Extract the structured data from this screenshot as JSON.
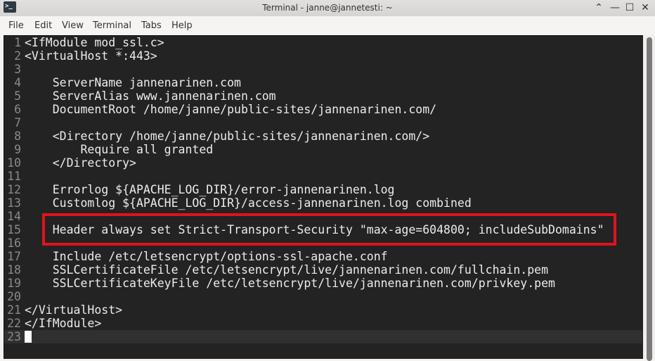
{
  "window": {
    "title": "Terminal - janne@jannetesti: ~",
    "icon_text": ">_"
  },
  "menu": [
    "File",
    "Edit",
    "View",
    "Terminal",
    "Tabs",
    "Help"
  ],
  "editor": {
    "current_line": 23,
    "highlighted_line": 15,
    "lines": [
      "<IfModule mod_ssl.c>",
      "<VirtualHost *:443>",
      "",
      "    ServerName jannenarinen.com",
      "    ServerAlias www.jannenarinen.com",
      "    DocumentRoot /home/janne/public-sites/jannenarinen.com/",
      "",
      "    <Directory /home/janne/public-sites/jannenarinen.com/>",
      "        Require all granted",
      "    </Directory>",
      "",
      "    Errorlog ${APACHE_LOG_DIR}/error-jannenarinen.log",
      "    Customlog ${APACHE_LOG_DIR}/access-jannenarinen.log combined",
      "",
      "    Header always set Strict-Transport-Security \"max-age=604800; includeSubDomains\"",
      "",
      "    Include /etc/letsencrypt/options-ssl-apache.conf",
      "    SSLCertificateFile /etc/letsencrypt/live/jannenarinen.com/fullchain.pem",
      "    SSLCertificateKeyFile /etc/letsencrypt/live/jannenarinen.com/privkey.pem",
      "",
      "</VirtualHost>",
      "</IfModule>",
      ""
    ]
  },
  "colors": {
    "highlight_box": "#e1131c",
    "terminal_bg": "#232323"
  }
}
